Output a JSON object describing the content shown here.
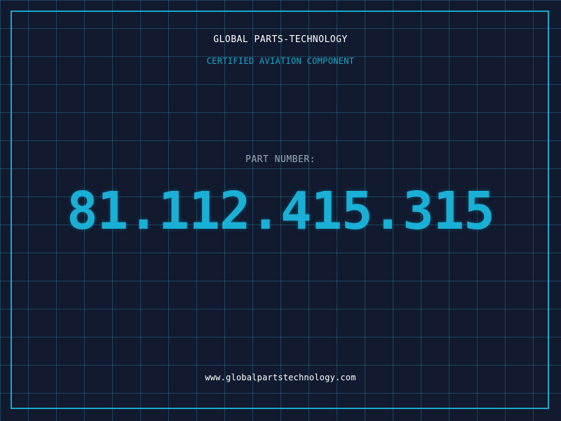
{
  "header": {
    "title": "GLOBAL PARTS-TECHNOLOGY",
    "subtitle": "CERTIFIED AVIATION COMPONENT"
  },
  "part": {
    "label": "PART NUMBER:",
    "number": "81.112.415.315"
  },
  "footer": {
    "url": "www.globalpartstechnology.com"
  },
  "colors": {
    "background": "#111a2e",
    "accent": "#1ca7c9",
    "grid": "#28788f",
    "text_primary": "#ffffff",
    "text_muted": "#9aa9b8"
  }
}
